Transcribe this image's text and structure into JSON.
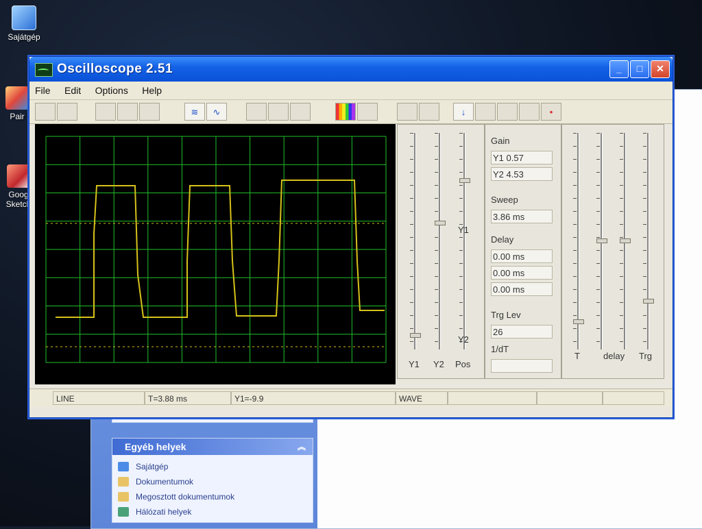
{
  "desktop": {
    "icons": [
      {
        "label": "Sajátgép"
      },
      {
        "label": "Pair"
      },
      {
        "label": "Goog Sketch"
      }
    ]
  },
  "explorer": {
    "panel_title": "Egyéb helyek",
    "items": [
      {
        "label": "Sajátgép",
        "icon": "computer-icon"
      },
      {
        "label": "Dokumentumok",
        "icon": "folder-icon"
      },
      {
        "label": "Megosztott dokumentumok",
        "icon": "folder-icon"
      },
      {
        "label": "Hálózati helyek",
        "icon": "network-icon"
      }
    ]
  },
  "window": {
    "title": "Oscilloscope 2.51",
    "minimize_glyph": "_",
    "maximize_glyph": "□",
    "close_glyph": "✕"
  },
  "menu": {
    "items": [
      "File",
      "Edit",
      "Options",
      "Help"
    ]
  },
  "toolbar": {
    "download_glyph": "↓",
    "wave_glyph": "∿",
    "multi_wave_glyph": "≋",
    "record_glyph": "•"
  },
  "scope": {
    "background": "#000000",
    "grid_color": "#1fbf2a",
    "trace_color": "#d6c21a",
    "waveform": "square"
  },
  "channels": {
    "labels": [
      "Y1",
      "Y2",
      "Pos"
    ],
    "marker_y1": "Y1",
    "marker_y2": "Y2"
  },
  "readout": {
    "gain_label": "Gain",
    "gain_y1": "Y1  0.57",
    "gain_y2": "Y2  4.53",
    "sweep_label": "Sweep",
    "sweep_value": "3.86 ms",
    "delay_label": "Delay",
    "delay_values": [
      "0.00 ms",
      "0.00 ms",
      "0.00 ms"
    ],
    "trig_label": "Trg Lev",
    "trig_value": "26",
    "idt_label": "1/dT",
    "idt_value": ""
  },
  "timing": {
    "labels": [
      "T",
      "delay",
      "Trg"
    ]
  },
  "status": {
    "mode": "LINE",
    "time": "T=3.88 ms",
    "y1": "Y1=-9.9",
    "display": "WAVE"
  }
}
